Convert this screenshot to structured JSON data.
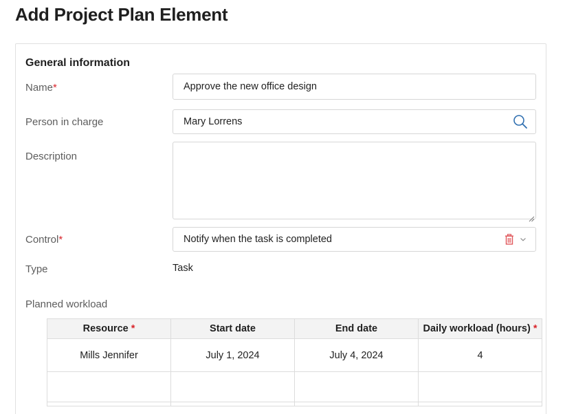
{
  "page": {
    "title": "Add Project Plan Element"
  },
  "general": {
    "section_title": "General information",
    "name": {
      "label": "Name",
      "required_mark": "*",
      "value": "Approve the new office design"
    },
    "person": {
      "label": "Person in charge",
      "value": "Mary Lorrens",
      "icon": "search-icon"
    },
    "description": {
      "label": "Description",
      "value": ""
    },
    "control": {
      "label": "Control",
      "required_mark": "*",
      "value": "Notify when the task is completed",
      "icons": [
        "trash-icon",
        "chevron-down-icon"
      ]
    },
    "type": {
      "label": "Type",
      "value": "Task"
    }
  },
  "workload": {
    "label": "Planned workload",
    "columns": [
      {
        "title": "Resource",
        "required_mark": "*"
      },
      {
        "title": "Start date",
        "required_mark": ""
      },
      {
        "title": "End date",
        "required_mark": ""
      },
      {
        "title": "Daily workload (hours)",
        "required_mark": "*"
      }
    ],
    "rows": [
      [
        "Mills Jennifer",
        "July 1, 2024",
        "July 4, 2024",
        "4"
      ]
    ]
  },
  "colors": {
    "required": "#d9262c",
    "search_icon": "#2f6fb0",
    "trash_icon": "#e0575b",
    "border": "#d6d6d6"
  }
}
